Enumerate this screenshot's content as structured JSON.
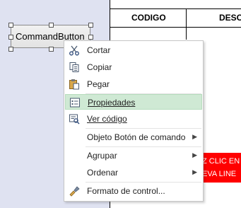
{
  "sheet": {
    "col_codigo": "CODIGO",
    "col_desc": "DESC",
    "red_line1": "Z CLIC EN",
    "red_line2": "EVA LINE"
  },
  "control": {
    "label": "CommandButton"
  },
  "context_menu": {
    "items": [
      {
        "icon": "scissors-icon",
        "label": "Cortar"
      },
      {
        "icon": "copy-icon",
        "label": "Copiar"
      },
      {
        "icon": "paste-icon",
        "label": "Pegar"
      },
      {
        "icon": "properties-icon",
        "label": "Propiedades",
        "highlighted": true
      },
      {
        "icon": "view-code-icon",
        "label": "Ver código"
      },
      {
        "label": "Objeto Botón de comando",
        "submenu": true
      },
      {
        "label": "Agrupar",
        "submenu": true
      },
      {
        "label": "Ordenar",
        "submenu": true
      },
      {
        "icon": "format-control-icon",
        "label": "Formato de control..."
      }
    ]
  },
  "colors": {
    "workarea": "#dfe2f1",
    "highlight": "#cfe9d4",
    "red_cell": "#ff0000"
  }
}
